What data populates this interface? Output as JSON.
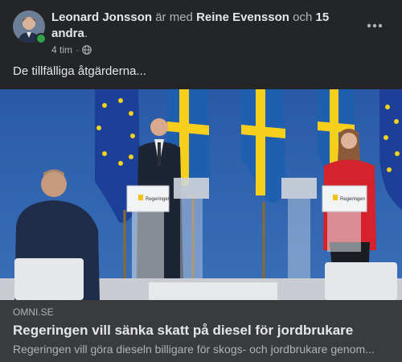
{
  "post": {
    "author": "Leonard Jonsson",
    "with_text": "är med",
    "tagged": "Reine Evensson",
    "and_text": "och",
    "others": "15 andra",
    "period": ".",
    "time": "4 tim",
    "separator": "·",
    "audience_icon": "globe-icon",
    "text": "De tillfälliga åtgärderna..."
  },
  "link": {
    "domain": "OMNI.SE",
    "title": "Regeringen vill sänka skatt på diesel för jordbrukare",
    "description": "Regeringen vill göra dieseln billigare för skogs- och jordbrukare genom..."
  },
  "photo": {
    "podium_label": "Regeringen"
  },
  "colors": {
    "background": "#242526",
    "link_box": "#3a3b3c",
    "text_primary": "#e4e6eb",
    "text_secondary": "#b0b3b8",
    "online": "#31a24c"
  }
}
